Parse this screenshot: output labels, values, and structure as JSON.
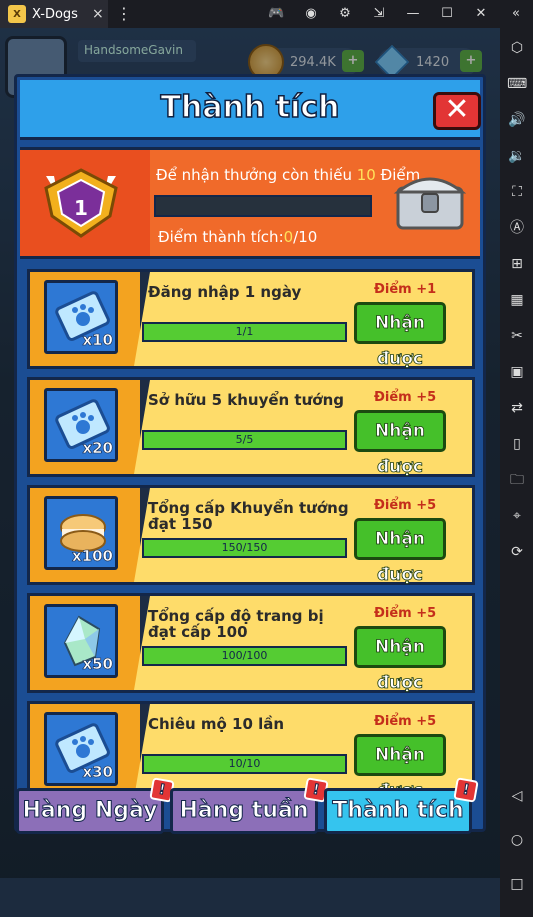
{
  "window": {
    "app_title": "X-Dogs",
    "close_glyph": "×",
    "menu_glyph": "⋮"
  },
  "toolbar": {
    "icons": [
      "gamepad-icon",
      "account-icon",
      "settings-icon",
      "popout-icon",
      "minimize-icon",
      "maximize-icon",
      "close-window-icon",
      "collapse-sidebar-icon"
    ]
  },
  "sidebar": {
    "icons": [
      "settings-hex-icon",
      "keyboard-icon",
      "volume-up-icon",
      "volume-down-icon",
      "fullscreen-icon",
      "auto-icon",
      "add-screenshot-icon",
      "apk-icon",
      "scissors-icon",
      "record-icon",
      "swap-icon",
      "shake-icon",
      "folder-icon",
      "location-icon",
      "rotate-icon",
      "back-icon",
      "home-icon",
      "recents-icon"
    ]
  },
  "hud": {
    "player_name": "HandsomeGavin",
    "gold": "294.4K",
    "gems": "1420",
    "plus": "+"
  },
  "panel": {
    "title": "Thành tích",
    "close_label": "✕"
  },
  "summary": {
    "req_prefix": "Để nhận thưởng còn thiếu ",
    "req_value": "10",
    "req_suffix": " Điểm",
    "points_prefix": "Điểm thành tích:",
    "points_current": "0",
    "points_total": "/10",
    "level": "1"
  },
  "rows": [
    {
      "title": "Đăng nhập 1 ngày",
      "progress": "1/1",
      "points": "Điểm +1",
      "button": "Nhận được",
      "qty": "x10",
      "icon": "paw-ticket-icon"
    },
    {
      "title": "Sở hữu 5 khuyển tướng",
      "progress": "5/5",
      "points": "Điểm +5",
      "button": "Nhận được",
      "qty": "x20",
      "icon": "paw-ticket-icon"
    },
    {
      "title": "Tổng cấp Khuyển tướng đạt 150",
      "progress": "150/150",
      "points": "Điểm +5",
      "button": "Nhận được",
      "qty": "x100",
      "icon": "macaron-icon"
    },
    {
      "title": "Tổng cấp độ trang bị đạt cấp 100",
      "progress": "100/100",
      "points": "Điểm +5",
      "button": "Nhận được",
      "qty": "x50",
      "icon": "crystal-icon"
    },
    {
      "title": "Chiêu mộ 10 lần",
      "progress": "10/10",
      "points": "Điểm +5",
      "button": "Nhận được",
      "qty": "x30",
      "icon": "paw-ticket-icon"
    }
  ],
  "tabs": [
    {
      "label": "Hàng Ngày",
      "notif": "!"
    },
    {
      "label": "Hàng tuần",
      "notif": "!"
    },
    {
      "label": "Thành tích",
      "notif": "!"
    }
  ],
  "colors": {
    "accent": "#2ea0ea",
    "claim": "#45c02a",
    "row_bg": "#fedc6a",
    "orange": "#f06a2a"
  }
}
